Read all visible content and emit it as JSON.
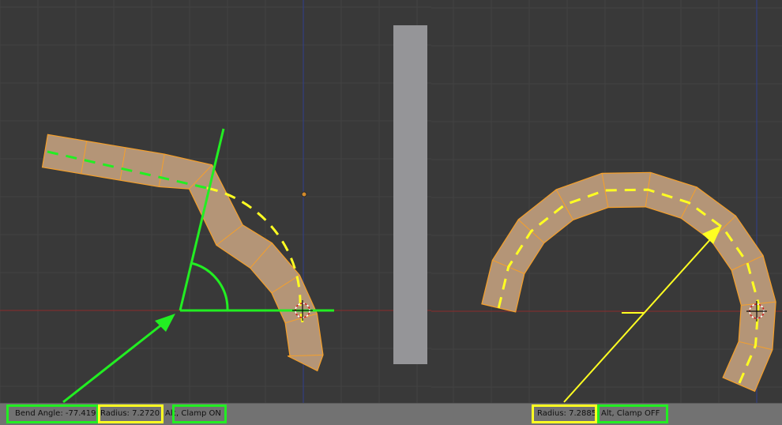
{
  "left_viewport": {
    "status": {
      "bend_angle": "Bend Angle: -77.419",
      "radius": "Radius: 7.2720",
      "alt_prefix": "Alt",
      "clamp": ", Clamp ON"
    }
  },
  "right_viewport": {
    "status": {
      "radius": "Radius: 7.2885",
      "clamp": "Alt, Clamp OFF"
    }
  },
  "colors": {
    "viewport_bg": "#393939",
    "grid": "#424242",
    "x_axis": "#8b2a2a",
    "y_axis": "#2f3f8f",
    "mesh_fill": "#b49577",
    "mesh_edge": "#f6a02a",
    "annotation_green": "#22ee22",
    "annotation_yellow": "#ffff22",
    "divider_bar": "#959598",
    "header_bg": "#727272"
  },
  "icons": {
    "pivot": "3d-cursor-icon",
    "origin": "object-origin-icon"
  }
}
